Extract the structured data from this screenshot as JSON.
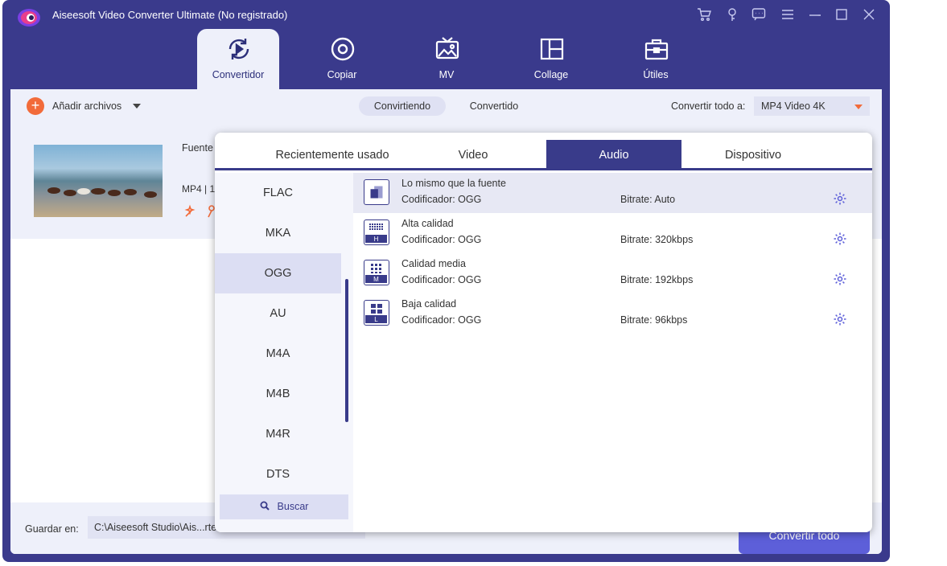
{
  "window": {
    "title": "Aiseesoft Video Converter Ultimate (No registrado)",
    "controls": [
      "cart-icon",
      "key-icon",
      "feedback-icon",
      "menu-icon",
      "minimize-icon",
      "maximize-icon",
      "close-icon"
    ]
  },
  "nav": {
    "tabs": [
      {
        "label": "Convertidor",
        "icon": "convert-icon",
        "active": true
      },
      {
        "label": "Copiar",
        "icon": "disc-icon",
        "active": false
      },
      {
        "label": "MV",
        "icon": "tv-icon",
        "active": false
      },
      {
        "label": "Collage",
        "icon": "collage-icon",
        "active": false
      },
      {
        "label": "Útiles",
        "icon": "toolbox-icon",
        "active": false
      }
    ]
  },
  "toolbar": {
    "add_label": "Añadir archivos",
    "seg_converting": "Convirtiendo",
    "seg_converted": "Convertido",
    "convert_all_label": "Convertir todo a:",
    "convert_all_value": "MP4 Video 4K"
  },
  "file": {
    "source_label": "Fuente",
    "format": "MP4 | 1"
  },
  "bottom": {
    "save_label": "Guardar en:",
    "save_path": "C:\\Aiseesoft Studio\\Ais...rte",
    "convert_all_button": "Convertir todo"
  },
  "panel": {
    "tabs": [
      {
        "label": "Recientemente usado",
        "active": false
      },
      {
        "label": "Video",
        "active": false
      },
      {
        "label": "Audio",
        "active": true
      },
      {
        "label": "Dispositivo",
        "active": false
      }
    ],
    "formats": [
      {
        "label": "FLAC",
        "selected": false
      },
      {
        "label": "MKA",
        "selected": false
      },
      {
        "label": "OGG",
        "selected": true
      },
      {
        "label": "AU",
        "selected": false
      },
      {
        "label": "M4A",
        "selected": false
      },
      {
        "label": "M4B",
        "selected": false
      },
      {
        "label": "M4R",
        "selected": false
      },
      {
        "label": "DTS",
        "selected": false
      }
    ],
    "search_label": "Buscar",
    "options": [
      {
        "name": "Lo mismo que la fuente",
        "encoder": "Codificador: OGG",
        "bitrate": "Bitrate: Auto",
        "badge": "",
        "selected": true
      },
      {
        "name": "Alta calidad",
        "encoder": "Codificador: OGG",
        "bitrate": "Bitrate: 320kbps",
        "badge": "H",
        "selected": false
      },
      {
        "name": "Calidad media",
        "encoder": "Codificador: OGG",
        "bitrate": "Bitrate: 192kbps",
        "badge": "M",
        "selected": false
      },
      {
        "name": "Baja calidad",
        "encoder": "Codificador: OGG",
        "bitrate": "Bitrate: 96kbps",
        "badge": "L",
        "selected": false
      }
    ]
  },
  "colors": {
    "brand": "#3a3a8c",
    "accent": "#f26b3a",
    "button": "#5d5fd9"
  }
}
